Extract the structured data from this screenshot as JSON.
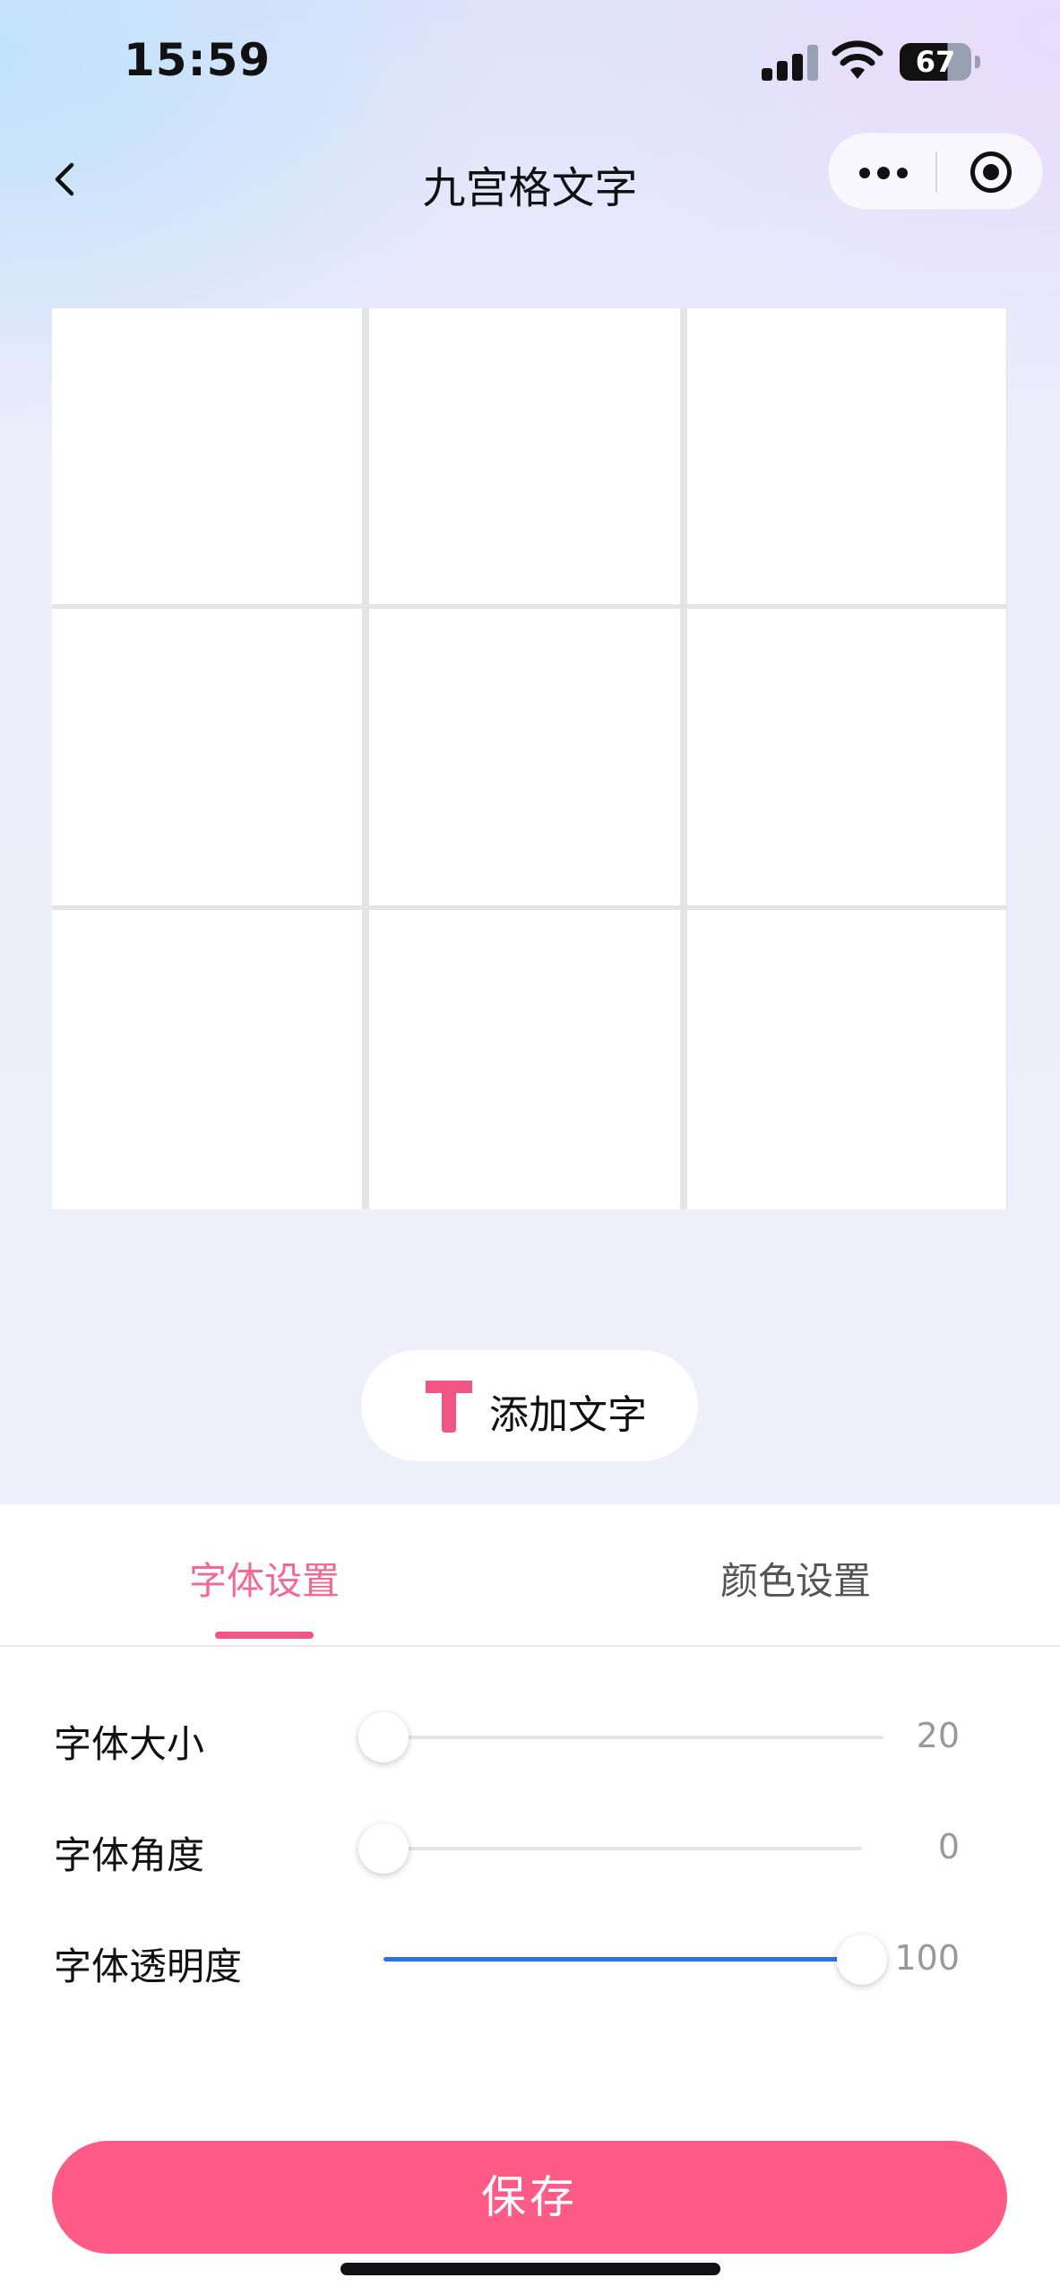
{
  "status_bar": {
    "time": "15:59",
    "battery": "67"
  },
  "nav": {
    "title": "九宫格文字"
  },
  "grid": {
    "rows": 3,
    "columns": 3
  },
  "add_text_button": {
    "label": "添加文字",
    "icon_color": "#f05583"
  },
  "tabs": [
    {
      "label": "字体设置",
      "active": true
    },
    {
      "label": "颜色设置",
      "active": false
    }
  ],
  "settings": {
    "font_size": {
      "label": "字体大小",
      "value": "20",
      "fraction": 0
    },
    "font_angle": {
      "label": "字体角度",
      "value": "0",
      "fraction": 0
    },
    "font_opacity": {
      "label": "字体透明度",
      "value": "100",
      "fraction": 1
    }
  },
  "save_button": {
    "label": "保存"
  },
  "colors": {
    "accent": "#ff5b87",
    "tab_active": "#f06a92",
    "slider_fill": "#2e74e0"
  }
}
